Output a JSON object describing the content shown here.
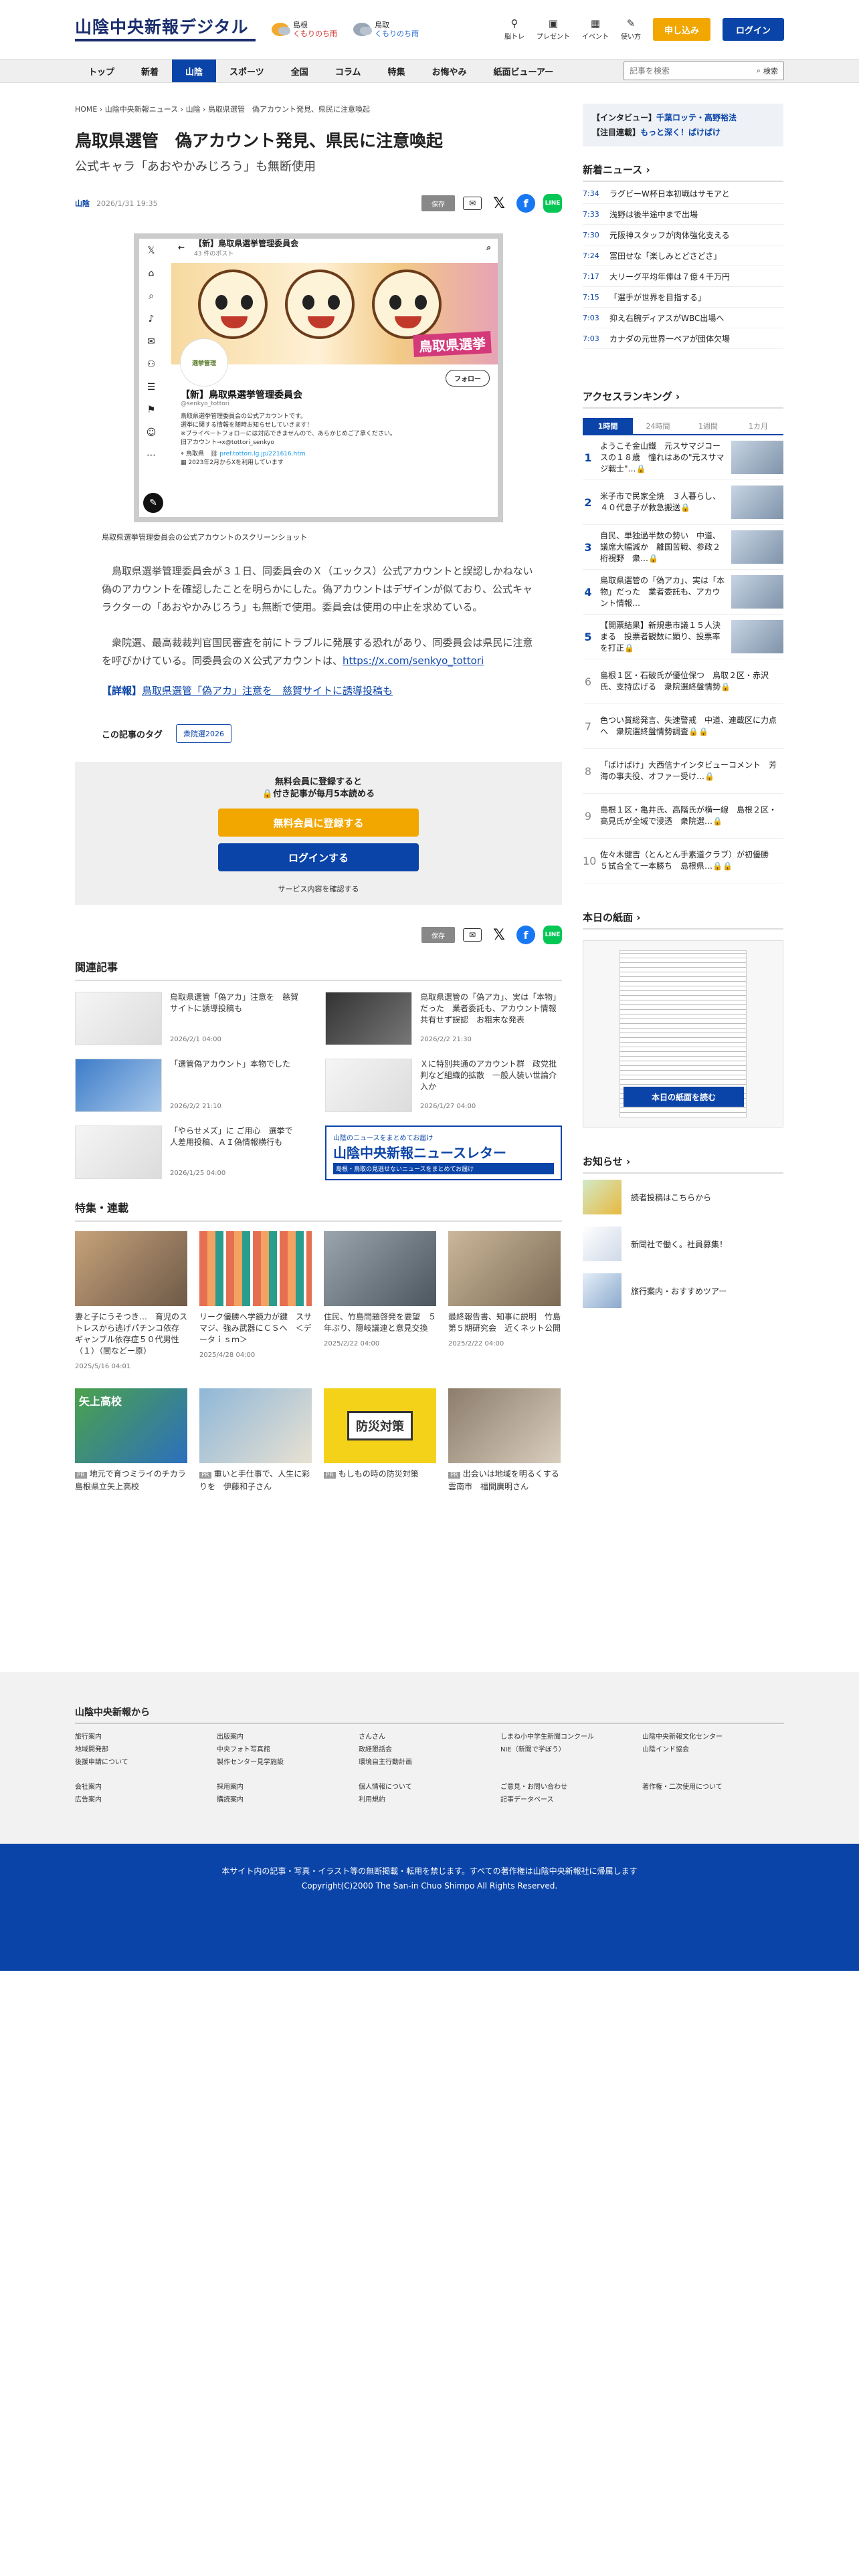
{
  "header": {
    "logo": "山陰中央新報デジタル",
    "weather": [
      {
        "pref": "島根",
        "desc": "くもりのち雨"
      },
      {
        "pref": "鳥取",
        "desc": "くもりのち雨"
      }
    ],
    "icons": [
      {
        "label": "脳トレ",
        "icon": "brain-icon"
      },
      {
        "label": "プレゼント",
        "icon": "gift-icon"
      },
      {
        "label": "イベント",
        "icon": "calendar-icon"
      },
      {
        "label": "使い方",
        "icon": "help-icon"
      }
    ],
    "subscribe": "申し込み",
    "login": "ログイン"
  },
  "nav": {
    "items": [
      "トップ",
      "新着",
      "山陰",
      "スポーツ",
      "全国",
      "コラム",
      "特集",
      "お悔やみ",
      "紙面ビューアー"
    ],
    "active": "山陰",
    "search_placeholder": "記事を検索",
    "search_button": "検索"
  },
  "article": {
    "breadcrumb": "HOME › 山陰中央新報ニュース › 山陰 › 鳥取県選管　偽アカウント発見、県民に注意喚起",
    "title": "鳥取県選管　偽アカウント発見、県民に注意喚起",
    "subtitle": "公式キャラ「あおやかみじろう」も無断使用",
    "category": "山陰",
    "date": "2026/1/31 19:35",
    "save": "保存",
    "figure": {
      "account_title": "【新】鳥取県選挙管理委員会",
      "posts": "43 件のポスト",
      "banner_text": "鳥取県選挙",
      "avatar_text": "選挙管理",
      "follow": "フォロー",
      "name": "【新】鳥取県選挙管理委員会",
      "handle": "@senkyo_tottori",
      "bio1": "鳥取県選挙管理委員会の公式アカウントです。",
      "bio2": "選挙に関する情報を随時お知らせしていきます！",
      "bio3": "※ブライベートフォローには対応できませんので、あらかじめご了承ください。",
      "bio4": "旧アカウント→x@tottori_senkyo",
      "loc": "鳥取県",
      "link": "pref.tottori.lg.jp/221616.htm",
      "joined": "2023年2月からXを利用しています",
      "caption": "鳥取県選挙管理委員会の公式アカウントのスクリーンショット"
    },
    "paragraphs": [
      "鳥取県選挙管理委員会が３１日、同委員会のＸ（エックス）公式アカウントと誤認しかねない偽のアカウントを確認したことを明らかにした。偽アカウントはデザインが似ており、公式キャラクターの「あおやかみじろう」も無断で使用。委員会は使用の中止を求めている。",
      "衆院選、最高裁裁判官国民審査を前にトラブルに発展する恐れがあり、同委員会は県民に注意を呼びかけている。同委員会のＸ公式アカウントは、"
    ],
    "official_url": "https://x.com/senkyo_tottori",
    "related_label": "【詳報】",
    "related_link": "鳥取県選管「偽アカ」注意を　慈賀サイトに誘導投稿も",
    "tags_label": "この記事のタグ",
    "tags": [
      "衆院選2026"
    ],
    "paywall": {
      "line1": "無料会員に登録すると",
      "line2": "🔒付き記事が毎月5本読める",
      "register": "無料会員に登録する",
      "login": "ログインする",
      "services": "サービス内容を確認する"
    }
  },
  "related": {
    "heading": "関連記事",
    "items": [
      {
        "title": "鳥取県選管「偽アカ」注意を　慈賀サイトに誘導投稿も",
        "date": "2026/2/1 04:00"
      },
      {
        "title": "鳥取県選管の「偽アカ」、実は「本物」だった　業者委託も、アカウント情報共有せず誤認　お粗末な発表",
        "date": "2026/2/2 21:30"
      },
      {
        "title": "「選管偽アカウント」本物でした",
        "date": "2026/2/2 21:10"
      },
      {
        "title": "Ｘに特別共通のアカウント群　政党批判など組織的拡散　一般人装い世論介入か",
        "date": "2026/1/27 04:00"
      },
      {
        "title": "「やらせメズ」に ご用心　選挙で人差用投稿、ＡＩ偽情報横行も",
        "date": "2026/1/25 04:00"
      }
    ],
    "newsletter": {
      "top": "山陰のニュースをまとめてお届け",
      "main": "山陰中央新報ニュースレター",
      "bottom": "島根・鳥取の見逃せないニュースをまとめてお届け"
    }
  },
  "features": {
    "heading": "特集・連載",
    "items": [
      {
        "title": "妻と子にうそつき…　育児のストレスから逃げパチンコ依存　ギャンブル依存症５０代男性（１）（闇などー原）",
        "date": "2025/5/16 04:01"
      },
      {
        "title": "リーク優勝へ学鏡力が鍵　スサマジ、強み武器にＣＳへ　＜データｉｓｍ＞",
        "date": "2025/4/28 04:00"
      },
      {
        "title": "住民、竹島問題啓発を要望　５年ぶり、隠岐議連と意見交換",
        "date": "2025/2/22 04:00"
      },
      {
        "title": "最終報告書、知事に説明　竹島第５期研究会　近くネット公開",
        "date": "2025/2/22 04:00"
      },
      {
        "title": "地元で育つミライのチカラ　島根県立矢上高校",
        "date": ""
      },
      {
        "title": "重いと手仕事で、人生に彩りを　伊藤和子さん",
        "date": ""
      },
      {
        "title": "もしもの時の防災対策",
        "date": ""
      },
      {
        "title": "出会いは地域を明るくする　雲南市　福間廣明さん",
        "date": ""
      }
    ],
    "pr": "PR",
    "f7_text": "防災対策",
    "f5_text": "矢上高校"
  },
  "sidebar": {
    "promo": [
      {
        "tag": "【インタビュー】",
        "link": "千葉ロッテ・高野裕法"
      },
      {
        "tag": "【注目連載】",
        "link": "もっと深く！ぱけぱけ"
      }
    ],
    "news_heading": "新着ニュース",
    "news": [
      {
        "time": "7:34",
        "title": "ラグビーW杯日本初戦はサモアと"
      },
      {
        "time": "7:33",
        "title": "浅野は後半途中まで出場"
      },
      {
        "time": "7:30",
        "title": "元阪神スタッフが肉体強化支える"
      },
      {
        "time": "7:24",
        "title": "冨田せな「楽しみとどさどさ」"
      },
      {
        "time": "7:17",
        "title": "大リーグ平均年俸は７億４千万円"
      },
      {
        "time": "7:15",
        "title": "「選手が世界を目指する」"
      },
      {
        "time": "7:03",
        "title": "抑え右腕ディアスがWBC出場へ"
      },
      {
        "time": "7:03",
        "title": "カナダの元世界一ペアが団体欠場"
      }
    ],
    "ranking_heading": "アクセスランキング",
    "ranking_tabs": [
      "1時間",
      "24時間",
      "1週間",
      "1カ月"
    ],
    "ranking": [
      {
        "n": "1",
        "title": "ようこそ金山鐵　元スサマジコースの１８歳　憧れはあの\"元スサマジ戦士\"…🔒"
      },
      {
        "n": "2",
        "title": "米子市で民家全焼　３人暮らし、４０代息子が救急搬送🔒"
      },
      {
        "n": "3",
        "title": "自民、単独過半数の勢い　中道、議席大幅減か　離国苦戦、参政２桁視野　衆…🔒"
      },
      {
        "n": "4",
        "title": "鳥取県選管の「偽アカ」、実は「本物」だった　業者委託も、アカウント情報…"
      },
      {
        "n": "5",
        "title": "【開票結果】新規患市議１５人決まる　投票者観数に顕り、投票率を打正🔒"
      },
      {
        "n": "6",
        "title": "島根１区・石破氏が優位保つ　鳥取２区・赤沢氏、支持広げる　衆院選終盤情勢🔒"
      },
      {
        "n": "7",
        "title": "色つい賞総発言、失速警戒　中道、連載区に力点へ　衆院選終盤情勢調査🔒🔒"
      },
      {
        "n": "8",
        "title": "「ばけばけ」大西信ナインタビューコメント　芳海の事夫役、オファー受け…🔒"
      },
      {
        "n": "9",
        "title": "島根１区・亀井氏、高階氏が横一線　島根２区・高見氏が全域で浸透　衆院選…🔒"
      },
      {
        "n": "10",
        "title": "佐々木健吉（とんとん手素道クラブ）が初優勝　５試合全て一本勝ち　島根県…🔒🔒"
      }
    ],
    "paper_heading": "本日の紙面",
    "paper_button": "本日の紙面を読む",
    "notice_heading": "お知らせ",
    "notices": [
      "読者投稿はこちらから",
      "新聞社で働く。社員募集！",
      "旅行案内・おすすめツアー"
    ]
  },
  "footer": {
    "heading": "山陰中央新報から",
    "links1": [
      "旅行案内",
      "出版案内",
      "さんさん",
      "しまね小中学生新聞コンクール",
      "山陰中央新報文化センター",
      "地域開発部",
      "中央フォト写真館",
      "政経懇話会",
      "NIE（新聞で学ぼう）",
      "山陰インド協会",
      "後援申請について",
      "製作センター見学施設",
      "環境自主行動計画",
      "",
      ""
    ],
    "links2": [
      "会社案内",
      "採用案内",
      "個人情報について",
      "ご意見・お問い合わせ",
      "著作権・二次使用について",
      "広告案内",
      "購読案内",
      "利用規約",
      "記事データベース",
      ""
    ],
    "copy1": "本サイト内の記事・写真・イラスト等の無断掲載・転用を禁じます。すべての著作権は山陰中央新報社に帰属します",
    "copy2": "Copyright(C)2000 The San-in Chuo Shimpo All Rights Reserved."
  }
}
